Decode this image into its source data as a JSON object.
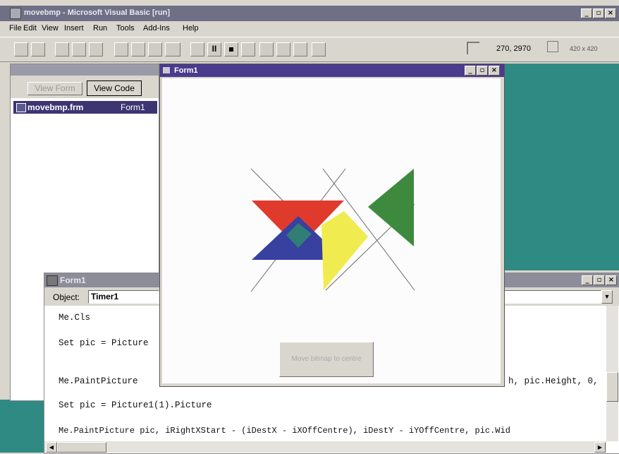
{
  "app": {
    "title": "movebmp - Microsoft Visual Basic [run]",
    "menu": [
      "File",
      "Edit",
      "View",
      "Insert",
      "Run",
      "Tools",
      "Add-Ins",
      "Help"
    ],
    "position_readout": "270, 2970",
    "size_readout": "420 x 420"
  },
  "project": {
    "view_form_label": "View Form",
    "view_code_label": "View Code",
    "file_name": "movebmp.frm",
    "form_name": "Form1"
  },
  "code_window": {
    "title": "Form1",
    "object_label": "Object:",
    "object_value": "Timer1",
    "lines": [
      "Me.Cls",
      "Set pic = Picture",
      "Me.PaintPicture",
      "Set pic = Picture1(1).Picture",
      "Me.PaintPicture pic, iRightXStart - (iDestX - iXOffCentre), iDestY - iYOffCentre, pic.Wid"
    ],
    "line3_tail": "h, pic.Height, 0,"
  },
  "form_window": {
    "title": "Form1",
    "button_label": "Move bitmap to centre"
  },
  "colors": {
    "desktop": "#2f8a84",
    "form_titlebar": "#4a3b8c",
    "triangle_red": "#e03a2c",
    "triangle_blue": "#3840a0",
    "triangle_yellow": "#f0ec50",
    "triangle_green": "#3d8a3e"
  }
}
